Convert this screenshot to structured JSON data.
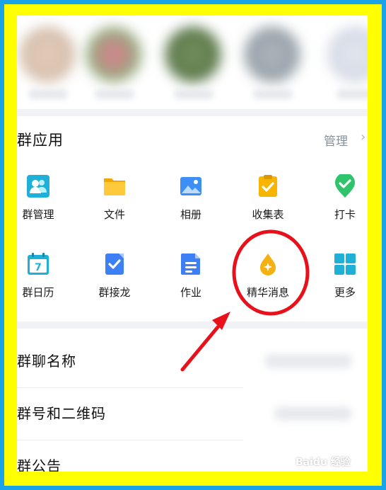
{
  "group_apps": {
    "section_title": "群应用",
    "manage_label": "管理",
    "manage_arrow": "›",
    "items": [
      {
        "label": "群管理",
        "icon": "group-manage-icon"
      },
      {
        "label": "文件",
        "icon": "folder-icon"
      },
      {
        "label": "相册",
        "icon": "photo-album-icon"
      },
      {
        "label": "收集表",
        "icon": "collection-form-icon"
      },
      {
        "label": "打卡",
        "icon": "check-in-icon"
      },
      {
        "label": "群日历",
        "icon": "calendar-icon"
      },
      {
        "label": "群接龙",
        "icon": "relay-icon"
      },
      {
        "label": "作业",
        "icon": "homework-icon"
      },
      {
        "label": "精华消息",
        "icon": "essence-message-icon"
      },
      {
        "label": "更多",
        "icon": "more-grid-icon"
      }
    ]
  },
  "settings_list": [
    {
      "title": "群聊名称"
    },
    {
      "title": "群号和二维码"
    },
    {
      "title": "群公告"
    }
  ],
  "calendar_day": "7",
  "watermark": "Baidu 经验",
  "colors": {
    "frame_outer": "#1aa3e8",
    "frame_inner": "#ffff00",
    "annotation_red": "#e8101a",
    "folder_yellow": "#f7b500",
    "accent_blue": "#3d7ff5",
    "check_green": "#2fc46b"
  }
}
